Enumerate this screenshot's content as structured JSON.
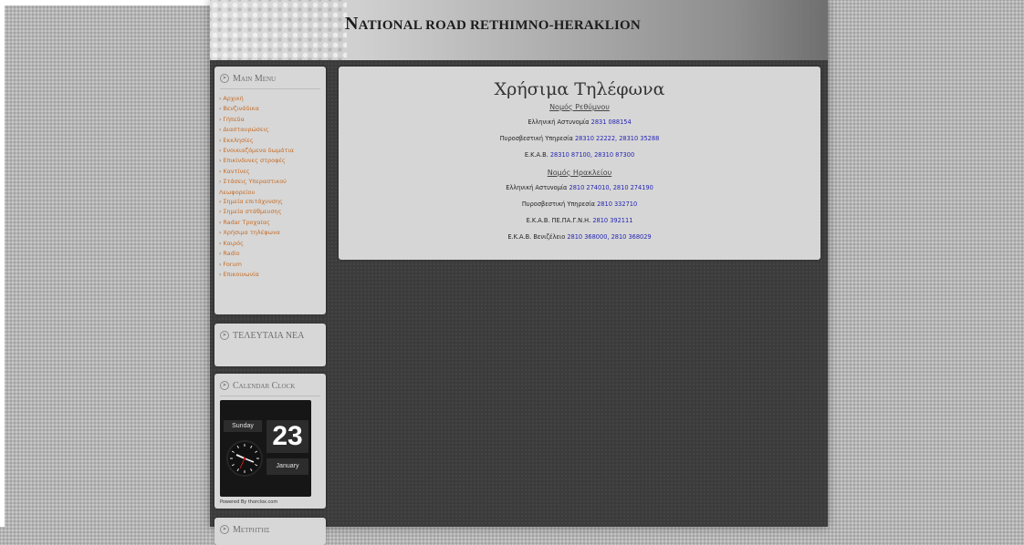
{
  "header": {
    "title_initial": "N",
    "title_rest": "ATIONAL ROAD RETHIMNO-HERAKLION"
  },
  "main_menu": {
    "title": "Main Menu",
    "items": [
      "Αρχική",
      "Βενζινάδικα",
      "Γήπεδα",
      "Διασταυρώσεις",
      "Εκκλησίες",
      "Ενοικιαζόμενα δωμάτια",
      "Επικίνδυνες στροφές",
      "Καντίνες",
      "Στάσεις Υπεραστικού Λεωφορείου",
      "Σημεία επιτάχυνσης",
      "Σημεία στάθμευσης",
      "Radar Τροχαίας",
      "Χρήσιμα τηλέφωνα",
      "Καιρός",
      "Radio",
      "Forum",
      "Επικοινωνία"
    ]
  },
  "latest_news": {
    "title": "ΤΕΛΕΥΤΑΙΑ ΝΕΑ"
  },
  "calendar_clock": {
    "title": "Calendar Clock",
    "day": "Sunday",
    "date": "23",
    "month": "January",
    "powered": "Powered By thorclox.com"
  },
  "visitors": {
    "title": "Μετρητής"
  },
  "content": {
    "title": "Χρήσιμα Τηλέφωνα",
    "sections": [
      {
        "heading": "Νομός Ρεθύμνου",
        "lines": [
          {
            "label": "Ελληνική Αστυνομία",
            "numbers": "2831 088154"
          },
          {
            "label": "Πυροσβεστική Υπηρεσία",
            "numbers": "28310 22222, 28310 35288"
          },
          {
            "label": "Ε.Κ.Α.Β.",
            "numbers": "28310 87100, 28310 87300"
          }
        ]
      },
      {
        "heading": "Νομός Ηρακλείου",
        "lines": [
          {
            "label": "Ελληνική Αστυνομία",
            "numbers": "2810 274010, 2810 274190"
          },
          {
            "label": "Πυροσβεστική Υπηρεσία",
            "numbers": "2810 332710"
          },
          {
            "label": "Ε.Κ.Α.Β. ΠΕ.ΠΑ.Γ.Ν.Η.",
            "numbers": "2810 392111"
          },
          {
            "label": "Ε.Κ.Α.Β. Βενιζέλειο",
            "numbers": "2810 368000, 2810 368029"
          }
        ]
      }
    ]
  },
  "colors": {
    "menu_link": "#c56d28",
    "phone_number": "#2424b4",
    "panel_bg": "#d6d6d6"
  }
}
